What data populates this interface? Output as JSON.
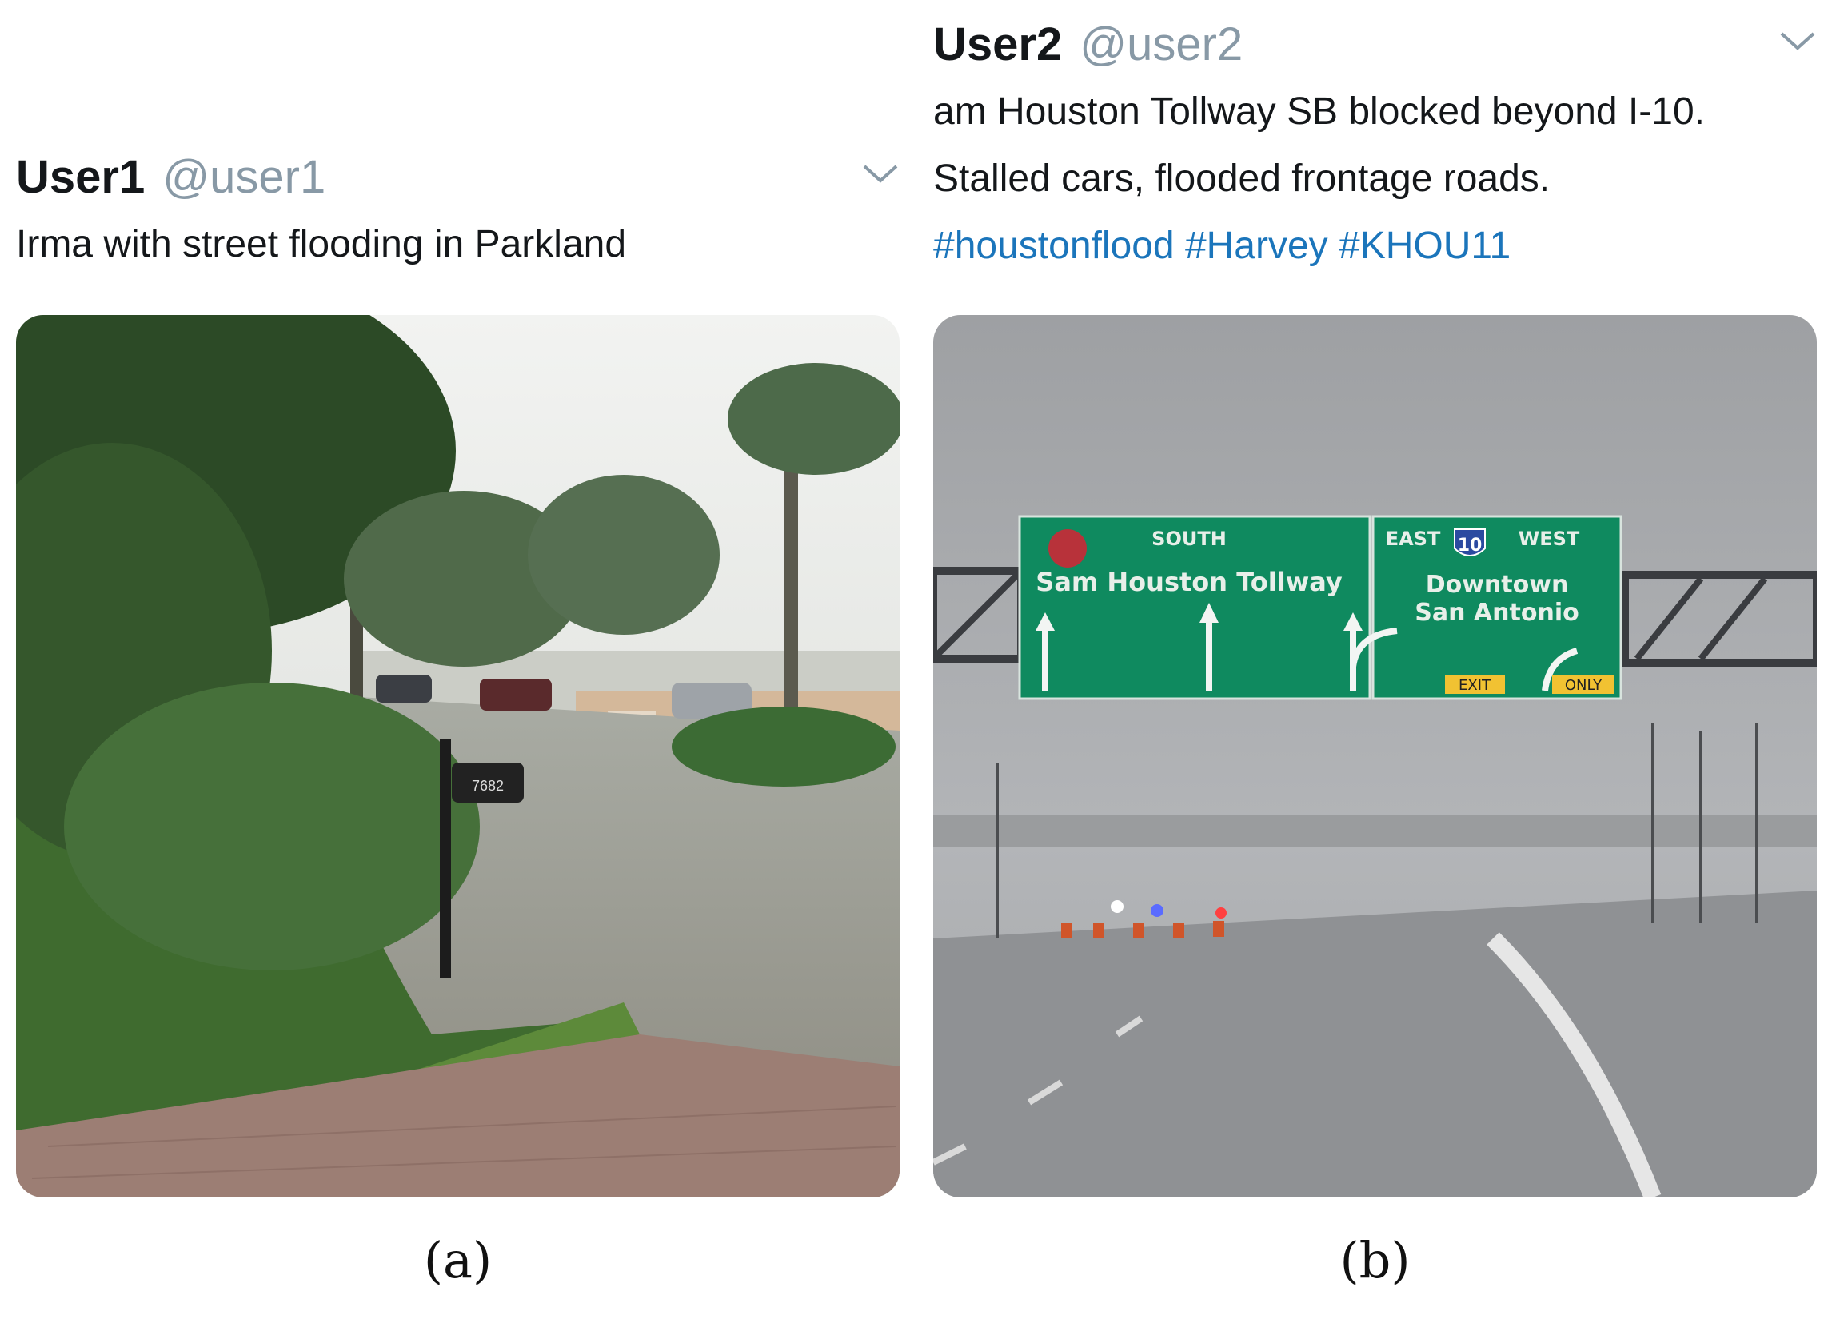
{
  "tweets": [
    {
      "name": "User1",
      "handle": "@user1",
      "lines": [
        "Irma with street flooding in Parkland"
      ],
      "photo_subject": "flooded residential street",
      "mailbox_number": "7682",
      "caption": "(a)"
    },
    {
      "name": "User2",
      "handle": "@user2",
      "lines": [
        "am Houston Tollway SB blocked beyond I-10.",
        "Stalled cars, flooded frontage roads."
      ],
      "hashtags": [
        "#houstonflood",
        "#Harvey",
        "#KHOU11"
      ],
      "photo_subject": "highway overhead sign in rain",
      "sign": {
        "left_direction": "SOUTH",
        "left_road": "Sam Houston Tollway",
        "right_direction_1": "EAST",
        "shield": "10",
        "right_direction_2": "WEST",
        "right_dest_1": "Downtown",
        "right_dest_2": "San Antonio",
        "exit": "EXIT",
        "only": "ONLY"
      },
      "caption": "(b)"
    }
  ],
  "icons": {
    "menu": "chevron-down-icon"
  },
  "colors": {
    "hashtag": "#1b75bb",
    "handle": "#8899a6",
    "sign_green": "#0f8a5f"
  }
}
